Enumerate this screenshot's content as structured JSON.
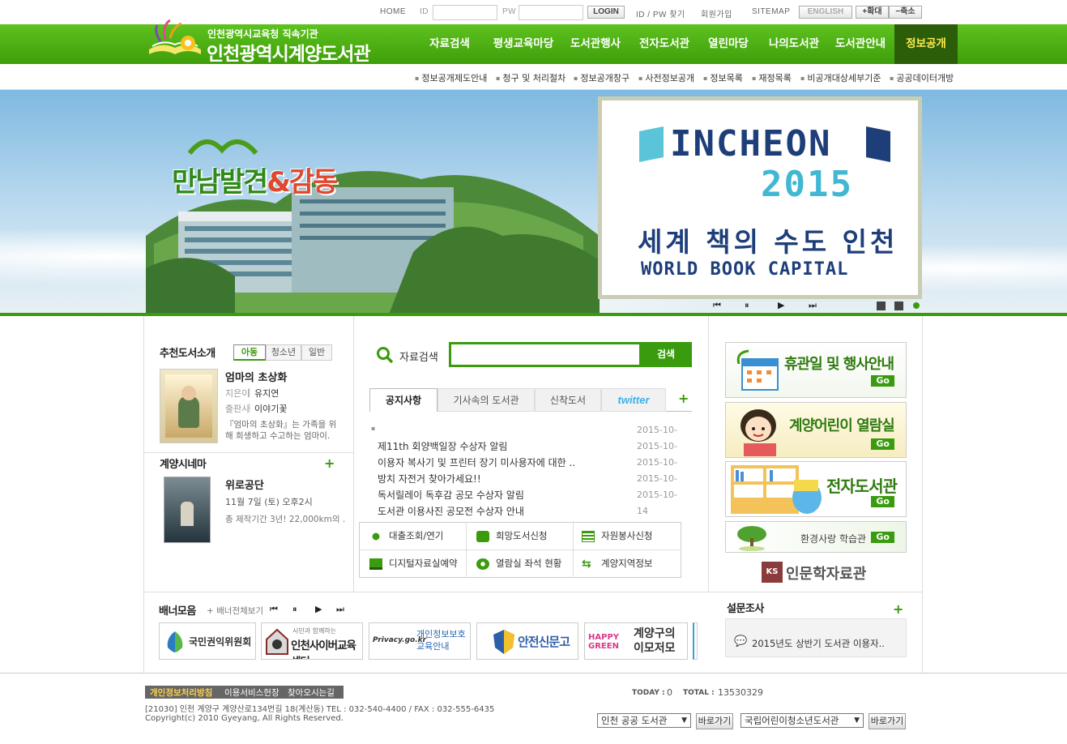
{
  "util": {
    "home": "HOME",
    "id_label": "ID",
    "pw_label": "PW",
    "login": "LOGIN",
    "find": "ID / PW 찾기",
    "join": "회원가입",
    "sitemap": "SITEMAP",
    "english": "ENGLISH",
    "zoom_in": "+확대",
    "zoom_out": "−축소"
  },
  "logo": {
    "sub": "인천광역시교육청 직속기관",
    "main": "인천광역시계양도서관"
  },
  "gnb": [
    "자료검색",
    "평생교육마당",
    "도서관행사",
    "전자도서관",
    "열린마당",
    "나의도서관",
    "도서관안내",
    "정보공개"
  ],
  "subnav": [
    "정보공개제도안내",
    "청구 및 처리절차",
    "정보공개창구",
    "사전정보공개",
    "정보목록",
    "재정목록",
    "비공개대상세부기준",
    "공공데이터개방"
  ],
  "banner": {
    "slogan_a": "만남",
    "slogan_b": "발견",
    "slogan_amp": "&",
    "slogan_c": "감동",
    "poster_line1": "INCHEON",
    "poster_line2": "2015",
    "poster_korean": "세계 책의 수도 인천",
    "poster_english": "WORLD BOOK CAPITAL"
  },
  "recommend": {
    "title": "추천도서소개",
    "tabs": [
      "아동",
      "청소년",
      "일반"
    ],
    "book_title": "엄마의 초상화",
    "author_label": "지은이",
    "author": "유지연",
    "publisher_label": "출판사",
    "publisher": "이야기꽃",
    "desc": "『엄마의 초상화』는 가족을 위해 희생하고 수고하는 엄마이."
  },
  "cinema": {
    "title": "계양시네마",
    "movie_title": "위로공단",
    "schedule": "11월 7일 (토) 오후2시",
    "desc": "총 제작기간 3년! 22,000km의 ."
  },
  "search": {
    "label": "자료검색",
    "button": "검색"
  },
  "notice": {
    "tabs": [
      "공지사항",
      "기사속의 도서관",
      "신착도서",
      "twitter"
    ],
    "items": [
      {
        "title": "",
        "date": "2015-10-"
      },
      {
        "title": "제11th 회양백일장 수상자 알림",
        "date": "2015-10-"
      },
      {
        "title": "이용자 복사기 및 프린터 장기 미사용자에 대한 ..",
        "date": "2015-10-"
      },
      {
        "title": "방치 자전거 찾아가세요!!",
        "date": "2015-10-"
      },
      {
        "title": "독서릴레이 독후감 공모 수상자 알림",
        "date": "2015-10-"
      },
      {
        "title": "도서관 이용사진 공모전 수상자 안내",
        "date": "14"
      }
    ]
  },
  "quick": [
    "대출조회/연기",
    "희망도서신청",
    "자원봉사신청",
    "디지털자료실예약",
    "열람실 좌석 현황",
    "계양지역정보"
  ],
  "side": {
    "b1": "휴관일 및 행사안내",
    "b2": "계양어린이 열람실",
    "b3": "전자도서관",
    "b4": "환경사랑 학습관",
    "go": "Go",
    "humanities": "인문학자료관"
  },
  "banners": {
    "title": "배너모음",
    "view_all": "+ 배너전체보기",
    "items": [
      "국민권익위원회",
      "인천사이버교육센터",
      "개인정보보호 교육안내",
      "안전신문고",
      "계양구의 이모저모"
    ],
    "privacy_logo": "Privacy.go.kr",
    "cyber_small": "시민과 함께하는",
    "happy_green": "HAPPY GREEN"
  },
  "survey": {
    "title": "설문조사",
    "item": "2015년도 상반기 도서관 이용자.."
  },
  "footer": {
    "links": [
      "개인정보처리방침",
      "이용서비스헌장",
      "찾아오시는길"
    ],
    "address": "[21030] 인천 계양구 계양산로134번길 18(계산동) TEL : 032-540-4400 / FAX : 032-555-6435",
    "copyright": "Copyright(c) 2010 Gyeyang, All Rights Reserved.",
    "today_label": "TODAY :",
    "today": "0",
    "total_label": "TOTAL :",
    "total": "13530329",
    "select1": "인천 공공 도서관",
    "select2": "국립어린이청소년도서관",
    "go": "바로가기"
  },
  "colors": {
    "brand_green": "#3a9b0e",
    "active_menu": "#2c5e09"
  }
}
